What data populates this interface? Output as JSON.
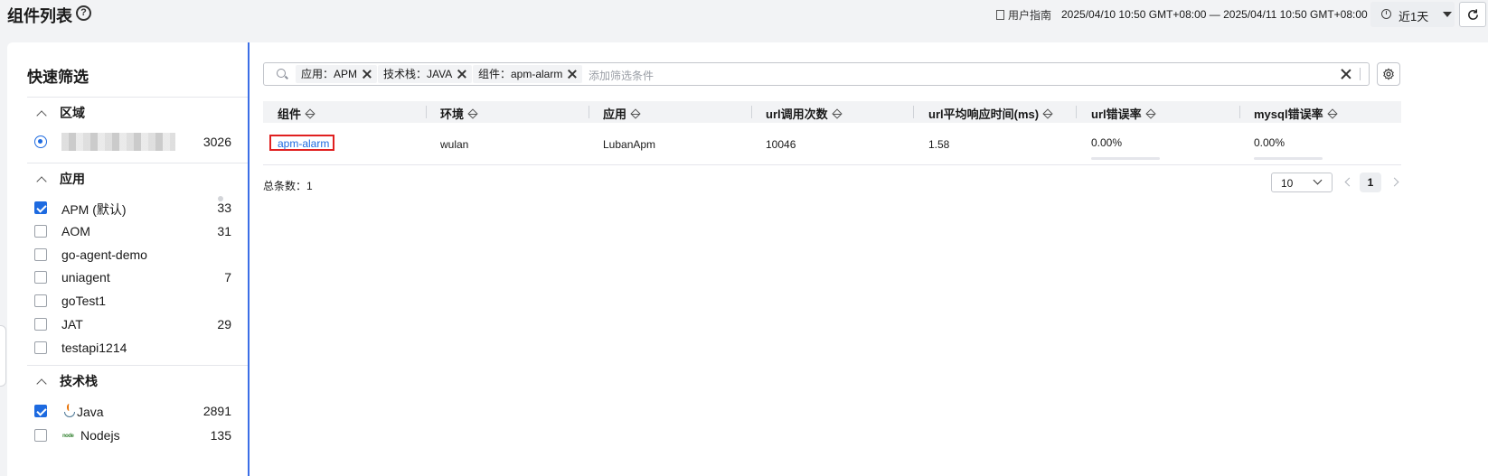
{
  "header": {
    "title": "组件列表",
    "help_icon": "?",
    "user_guide": "用户指南",
    "time_range": "2025/04/10 10:50 GMT+08:00 — 2025/04/11 10:50 GMT+08:00",
    "range_label": "近1天"
  },
  "sidebar": {
    "title": "快速筛选",
    "sections": {
      "region": {
        "title": "区域",
        "items": [
          {
            "label": "",
            "count": "3026",
            "selected": true
          }
        ]
      },
      "app": {
        "title": "应用",
        "items": [
          {
            "label": "APM (默认)",
            "count": "33",
            "checked": true
          },
          {
            "label": "AOM",
            "count": "31",
            "checked": false
          },
          {
            "label": "go-agent-demo",
            "count": "",
            "checked": false
          },
          {
            "label": "uniagent",
            "count": "7",
            "checked": false
          },
          {
            "label": "goTest1",
            "count": "",
            "checked": false
          },
          {
            "label": "JAT",
            "count": "29",
            "checked": false
          },
          {
            "label": "testapi1214",
            "count": "",
            "checked": false
          }
        ]
      },
      "stack": {
        "title": "技术栈",
        "items": [
          {
            "label": "Java",
            "count": "2891",
            "checked": true,
            "icon": "java-icon"
          },
          {
            "label": "Nodejs",
            "count": "135",
            "checked": false,
            "icon": "nodejs-icon",
            "icon_text": "node"
          }
        ]
      }
    }
  },
  "filter": {
    "tags": [
      "应用：APM",
      "技术栈：JAVA",
      "组件：apm-alarm"
    ],
    "placeholder": "添加筛选条件"
  },
  "table": {
    "columns": [
      "组件",
      "环境",
      "应用",
      "url调用次数",
      "url平均响应时间(ms)",
      "url错误率",
      "mysql错误率"
    ],
    "rows": [
      {
        "component": "apm-alarm",
        "env": "wulan",
        "app": "LubanApm",
        "url_calls": "10046",
        "url_avg_ms": "1.58",
        "url_err": "0.00%",
        "url_err_value": 0,
        "mysql_err": "0.00%",
        "mysql_err_value": 0
      }
    ],
    "total": "总条数：1",
    "page_size": "10",
    "current_page": "1"
  },
  "colors": {
    "primary": "#1d6ae0",
    "highlight_border": "#e02020",
    "divider": "#3b6ee6"
  }
}
